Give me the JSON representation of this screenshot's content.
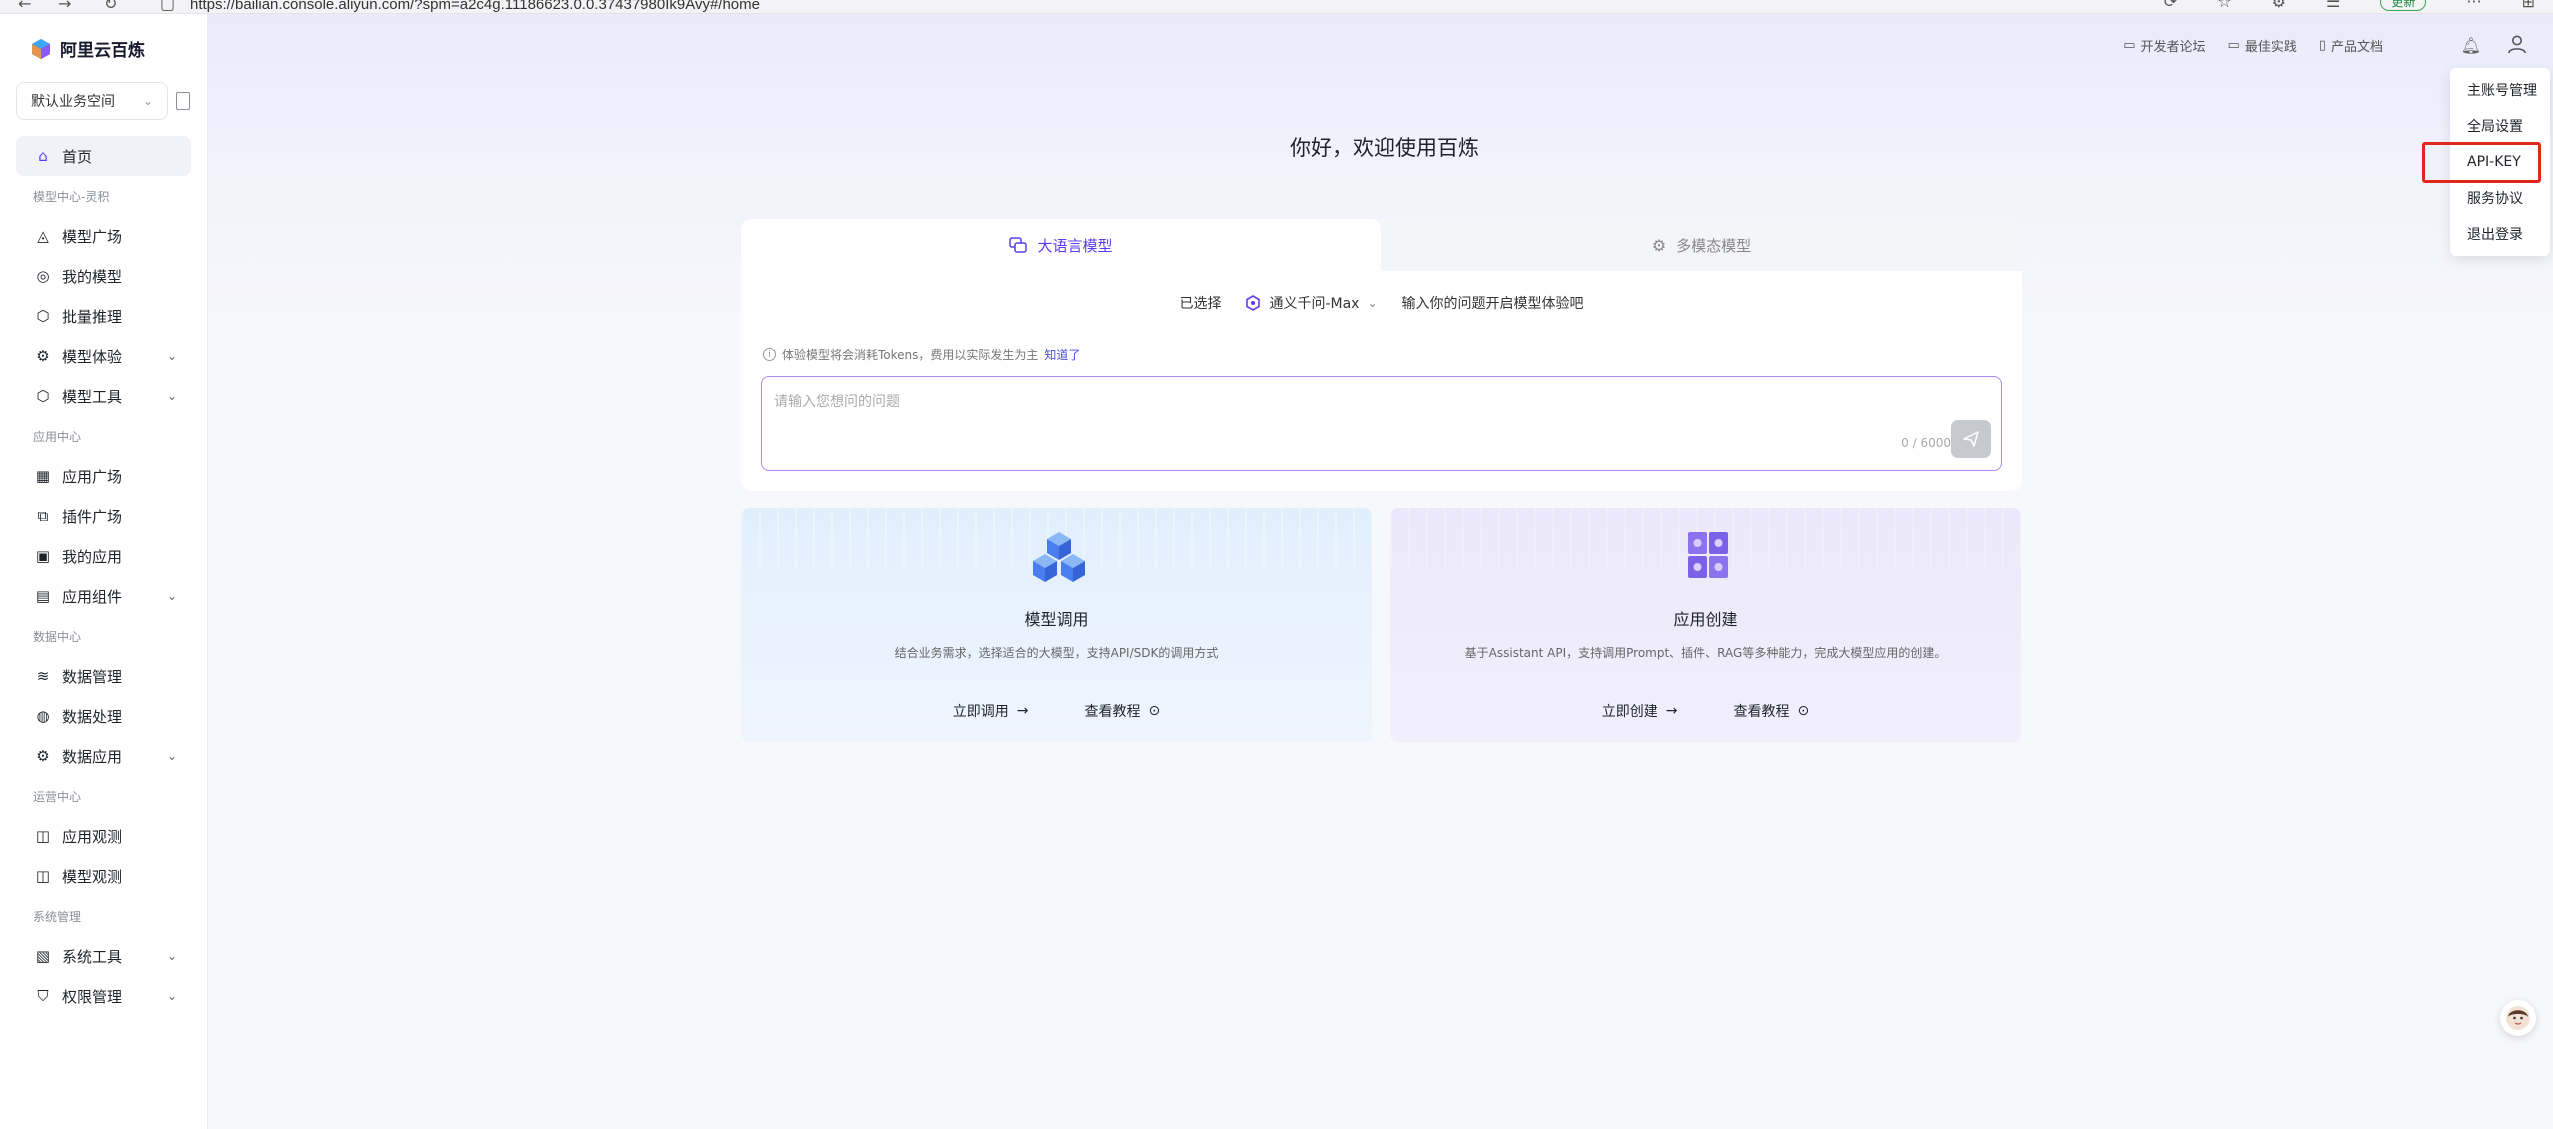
{
  "browser": {
    "url": "https://bailian.console.aliyun.com/?spm=a2c4g.11186623.0.0.37437980Ik9Avy#/home",
    "update_label": "更新"
  },
  "sidebar": {
    "logo_text": "阿里云百炼",
    "workspace": "默认业务空间",
    "items": [
      {
        "type": "item",
        "label": "首页",
        "icon": "home-icon",
        "active": true
      },
      {
        "type": "section",
        "label": "模型中心-灵积"
      },
      {
        "type": "item",
        "label": "模型广场",
        "icon": "model-square-icon"
      },
      {
        "type": "item",
        "label": "我的模型",
        "icon": "my-model-icon"
      },
      {
        "type": "item",
        "label": "批量推理",
        "icon": "batch-inference-icon"
      },
      {
        "type": "item",
        "label": "模型体验",
        "icon": "model-experience-icon",
        "expandable": true
      },
      {
        "type": "item",
        "label": "模型工具",
        "icon": "model-tools-icon",
        "expandable": true
      },
      {
        "type": "section",
        "label": "应用中心"
      },
      {
        "type": "item",
        "label": "应用广场",
        "icon": "app-square-icon"
      },
      {
        "type": "item",
        "label": "插件广场",
        "icon": "plugin-square-icon"
      },
      {
        "type": "item",
        "label": "我的应用",
        "icon": "my-app-icon"
      },
      {
        "type": "item",
        "label": "应用组件",
        "icon": "app-components-icon",
        "expandable": true
      },
      {
        "type": "section",
        "label": "数据中心"
      },
      {
        "type": "item",
        "label": "数据管理",
        "icon": "data-management-icon"
      },
      {
        "type": "item",
        "label": "数据处理",
        "icon": "data-processing-icon"
      },
      {
        "type": "item",
        "label": "数据应用",
        "icon": "data-application-icon",
        "expandable": true
      },
      {
        "type": "section",
        "label": "运营中心"
      },
      {
        "type": "item",
        "label": "应用观测",
        "icon": "app-observation-icon"
      },
      {
        "type": "item",
        "label": "模型观测",
        "icon": "model-observation-icon"
      },
      {
        "type": "section",
        "label": "系统管理"
      },
      {
        "type": "item",
        "label": "系统工具",
        "icon": "system-tools-icon",
        "expandable": true
      },
      {
        "type": "item",
        "label": "权限管理",
        "icon": "permission-management-icon",
        "expandable": true
      }
    ]
  },
  "header": {
    "links": [
      "开发者论坛",
      "最佳实践",
      "产品文档"
    ]
  },
  "user_menu": {
    "items": [
      "主账号管理",
      "全局设置",
      "API-KEY",
      "服务协议",
      "退出登录"
    ],
    "highlighted": "API-KEY"
  },
  "main": {
    "greeting": "你好，欢迎使用百炼",
    "tabs": [
      "大语言模型",
      "多模态模型"
    ],
    "selected_label": "已选择",
    "selected_model": "通义千问-Max",
    "selector_hint": "输入你的问题开启模型体验吧",
    "tip_text": "体验模型将会消耗Tokens，费用以实际发生为主",
    "tip_link": "知道了",
    "prompt_placeholder": "请输入您想问的问题",
    "char_count": "0 / 6000"
  },
  "cards": [
    {
      "title": "模型调用",
      "desc": "结合业务需求，选择适合的大模型，支持API/SDK的调用方式",
      "action_primary": "立即调用",
      "action_secondary": "查看教程",
      "accent": "#4a7ef0"
    },
    {
      "title": "应用创建",
      "desc": "基于Assistant API，支持调用Prompt、插件、RAG等多种能力，完成大模型应用的创建。",
      "action_primary": "立即创建",
      "action_secondary": "查看教程",
      "accent": "#7a62e8"
    }
  ],
  "colors": {
    "brand_purple": "#5b3df5",
    "highlight_red": "#e1261c",
    "active_nav_bg": "#f1f2f7"
  }
}
